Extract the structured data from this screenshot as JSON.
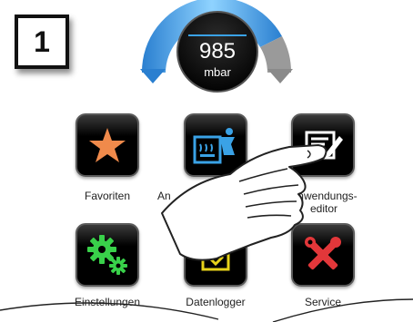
{
  "step": {
    "number": "1"
  },
  "gauge": {
    "value": "985",
    "unit": "mbar",
    "accent": "#3aa2e6"
  },
  "tiles": [
    {
      "label": "Favoriten",
      "icon": "star-icon"
    },
    {
      "label": "An",
      "icon": "application-icon"
    },
    {
      "label": "Anwendungs-\neditor",
      "icon": "application-editor-icon"
    },
    {
      "label": "Einstellungen",
      "icon": "settings-gears-icon"
    },
    {
      "label": "Datenlogger",
      "icon": "data-logger-icon"
    },
    {
      "label": "Service",
      "icon": "service-tools-icon"
    }
  ]
}
